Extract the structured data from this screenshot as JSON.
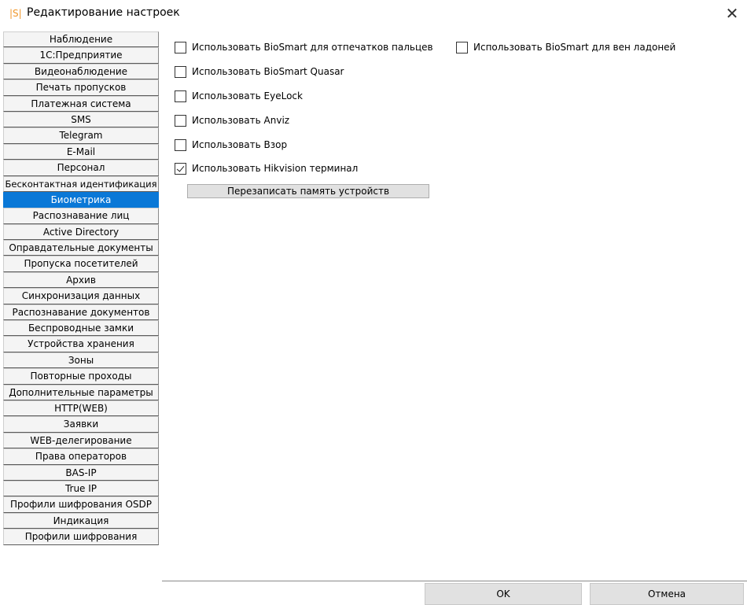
{
  "window": {
    "logo": "|S|",
    "title": "Редактирование настроек",
    "close_glyph": "✕"
  },
  "sidebar": {
    "active_index": 10,
    "items": [
      {
        "label": "Наблюдение"
      },
      {
        "label": "1С:Предприятие"
      },
      {
        "label": "Видеонаблюдение"
      },
      {
        "label": "Печать пропусков"
      },
      {
        "label": "Платежная система"
      },
      {
        "label": "SMS"
      },
      {
        "label": "Telegram"
      },
      {
        "label": "E-Mail"
      },
      {
        "label": "Персонал"
      },
      {
        "label": "Бесконтактная идентификация"
      },
      {
        "label": "Биометрика"
      },
      {
        "label": "Распознавание лиц"
      },
      {
        "label": "Active Directory"
      },
      {
        "label": "Оправдательные документы"
      },
      {
        "label": "Пропуска посетителей"
      },
      {
        "label": "Архив"
      },
      {
        "label": "Синхронизация данных"
      },
      {
        "label": "Распознавание документов"
      },
      {
        "label": "Беспроводные замки"
      },
      {
        "label": "Устройства хранения"
      },
      {
        "label": "Зоны"
      },
      {
        "label": "Повторные проходы"
      },
      {
        "label": "Дополнительные параметры"
      },
      {
        "label": "HTTP(WEB)"
      },
      {
        "label": "Заявки"
      },
      {
        "label": "WEB-делегирование"
      },
      {
        "label": "Права операторов"
      },
      {
        "label": "BAS-IP"
      },
      {
        "label": "True IP"
      },
      {
        "label": "Профили шифрования OSDP"
      },
      {
        "label": "Индикация"
      },
      {
        "label": "Профили шифрования"
      }
    ]
  },
  "biometrics": {
    "options": [
      {
        "label": "Использовать BioSmart для отпечатков пальцев",
        "checked": false
      },
      {
        "label": "Использовать BioSmart для вен ладоней",
        "checked": false
      },
      {
        "label": "Использовать BioSmart Quasar",
        "checked": false
      },
      {
        "label": "Использовать EyeLock",
        "checked": false
      },
      {
        "label": "Использовать Anviz",
        "checked": false
      },
      {
        "label": "Использовать Взор",
        "checked": false
      },
      {
        "label": "Использовать Hikvision терминал",
        "checked": true
      }
    ],
    "rewrite_button": "Перезаписать память устройств"
  },
  "footer": {
    "ok_label": "OK",
    "cancel_label": "Отмена"
  }
}
